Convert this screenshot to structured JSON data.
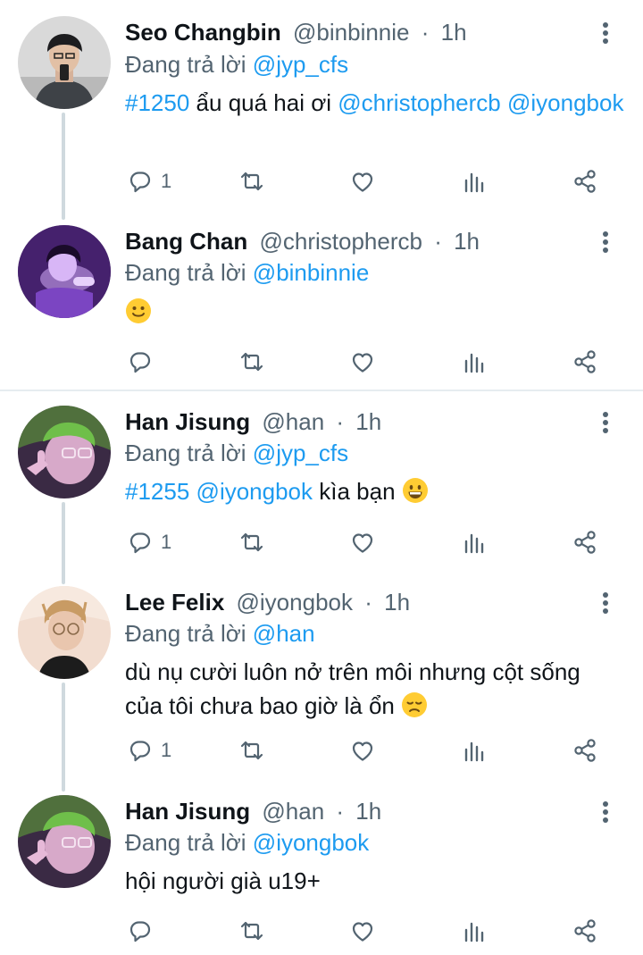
{
  "reply_prefix": "Đang trả lời",
  "dot": "·",
  "tweets": [
    {
      "name": "Seo Changbin",
      "handle": "@binbinnie",
      "time": "1h",
      "reply_to": "@jyp_cfs",
      "text_hashtag": "#1250",
      "text_main": "ẩu quá hai ơi",
      "text_mention1": "@christophercb",
      "text_mention2": "@iyongbok",
      "reply_count": "1"
    },
    {
      "name": "Bang Chan",
      "handle": "@christophercb",
      "time": "1h",
      "reply_to": "@binbinnie",
      "emoji": "slightly-smiling-face-emoji",
      "reply_count": ""
    },
    {
      "name": "Han Jisung",
      "handle": "@han",
      "time": "1h",
      "reply_to": "@jyp_cfs",
      "text_hashtag": "#1255",
      "text_mention1": "@iyongbok",
      "text_main": "kìa bạn",
      "emoji": "grinning-face-emoji",
      "reply_count": "1"
    },
    {
      "name": "Lee Felix",
      "handle": "@iyongbok",
      "time": "1h",
      "reply_to": "@han",
      "text_main": "dù nụ cười luôn nở trên môi nhưng cột sống của tôi chưa bao giờ là ổn",
      "emoji": "disappointed-face-emoji",
      "reply_count": "1"
    },
    {
      "name": "Han Jisung",
      "handle": "@han",
      "time": "1h",
      "reply_to": "@iyongbok",
      "text_main": "hội người già u19+",
      "reply_count": ""
    }
  ],
  "icons": {
    "reply": "reply-icon",
    "retweet": "retweet-icon",
    "like": "heart-icon",
    "views": "analytics-icon",
    "share": "share-icon",
    "more": "more-vertical-icon"
  },
  "colors": {
    "link": "#1d9bf0",
    "secondary": "#536471",
    "text": "#0f1419",
    "thread_line": "#cfd9de"
  }
}
